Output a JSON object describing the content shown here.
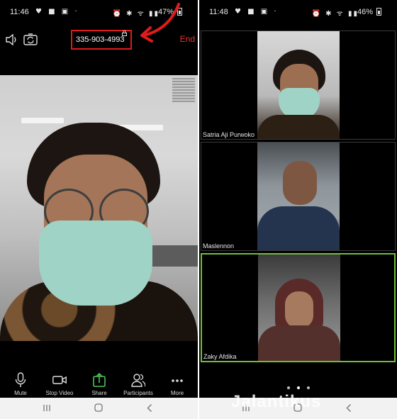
{
  "left_screen": {
    "status": {
      "time": "11:46",
      "notifications": "♥ ■ ▣ ·",
      "system": "⏰ ✱ ᯤ ▮▮",
      "battery": "47%"
    },
    "meeting_id": "335-903-4993",
    "end_label": "End",
    "toolbar": [
      {
        "label": "Mute",
        "icon": "microphone-icon"
      },
      {
        "label": "Stop Video",
        "icon": "video-camera-icon"
      },
      {
        "label": "Share",
        "icon": "share-icon"
      },
      {
        "label": "Participants",
        "icon": "participants-icon"
      },
      {
        "label": "More",
        "icon": "more-icon"
      }
    ],
    "highlight_color": "#e01b1b",
    "end_color": "#e8322b"
  },
  "right_screen": {
    "status": {
      "time": "11:48",
      "notifications": "♥ ■ ▣ ·",
      "system": "⏰ ✱ ᯤ ▮▮",
      "battery": "46%"
    },
    "participants": [
      {
        "name": "Satria Aji Purwoko",
        "active": false
      },
      {
        "name": "Maslennon",
        "active": false
      },
      {
        "name": "Zaky Afdika",
        "active": true
      }
    ],
    "active_speaker_color": "#6fbf3b",
    "page_dots": 3,
    "current_page": 1
  },
  "watermark": "Jalantikus"
}
